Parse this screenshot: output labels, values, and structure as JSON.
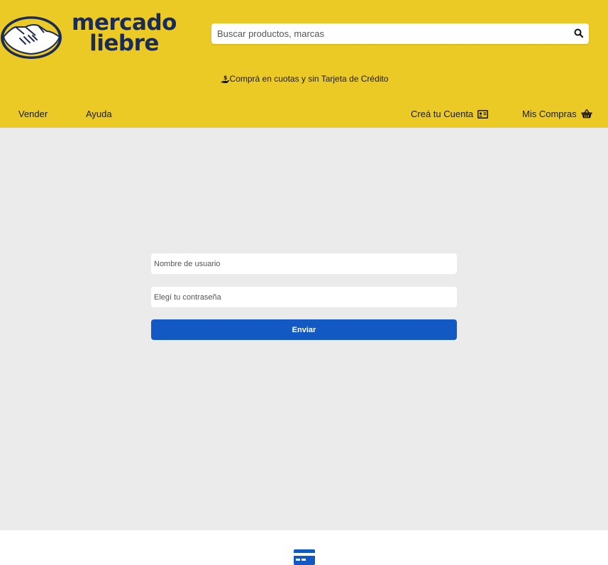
{
  "header": {
    "logo": {
      "line1": "mercado",
      "line2": "liebre"
    },
    "search": {
      "placeholder": "Buscar productos, marcas",
      "icon": "search-icon"
    },
    "promo": {
      "text": "Comprá en cuotas y sin Tarjeta de Crédito",
      "icon": "hand-money-icon"
    },
    "nav": {
      "sell": "Vender",
      "help": "Ayuda",
      "create_account": {
        "label": "Creá tu Cuenta",
        "icon": "id-card-icon"
      },
      "purchases": {
        "label": "Mis Compras",
        "icon": "shopping-basket-icon"
      }
    }
  },
  "form": {
    "username_placeholder": "Nombre de usuario",
    "password_placeholder": "Elegí tu contraseña",
    "submit_label": "Enviar"
  },
  "footer": {
    "icon": "credit-card-icon"
  },
  "colors": {
    "header_bg": "#ecca25",
    "page_bg": "#ebebeb",
    "button_bg": "#1259c3",
    "logo_text": "#1a2b57"
  }
}
